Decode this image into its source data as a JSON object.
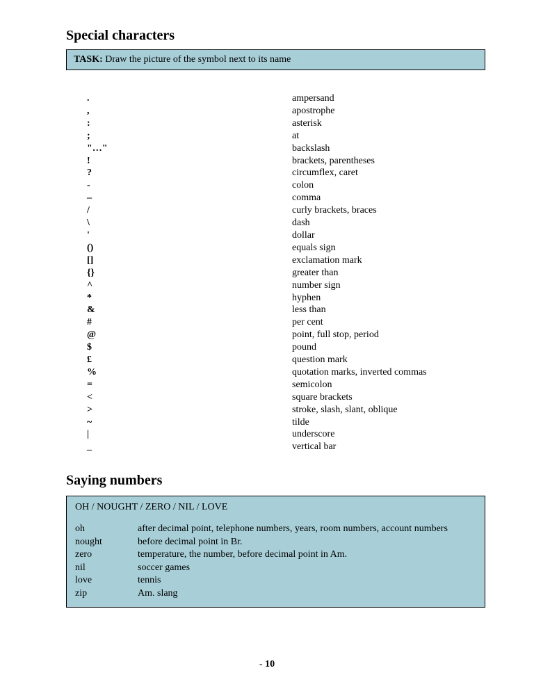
{
  "heading1": "Special characters",
  "task": {
    "label": "TASK:",
    "text": " Draw the picture of the symbol next to its name"
  },
  "symbols": [
    ".",
    ",",
    ":",
    ";",
    "\"…\"",
    "!",
    "?",
    "-",
    "–",
    "/",
    "\\",
    "'",
    "()",
    "[]",
    "{}",
    "^",
    "*",
    "&",
    "#",
    "@",
    "$",
    "£",
    "%",
    "=",
    "<",
    ">",
    "~",
    "|",
    "_"
  ],
  "names": [
    "ampersand",
    "apostrophe",
    "asterisk",
    "at",
    "backslash",
    "brackets, parentheses",
    "circumflex, caret",
    "colon",
    "comma",
    "curly brackets, braces",
    "dash",
    "dollar",
    "equals sign",
    "exclamation mark",
    "greater than",
    "number sign",
    "hyphen",
    "less than",
    "per cent",
    "point, full stop, period",
    "pound",
    "question mark",
    "quotation marks, inverted commas",
    "semicolon",
    "square brackets",
    "stroke, slash, slant, oblique",
    "tilde",
    "underscore",
    "vertical bar"
  ],
  "heading2": "Saying numbers",
  "numbersBox": {
    "title": "OH / NOUGHT / ZERO / NIL / LOVE",
    "rows": [
      {
        "term": "oh",
        "def": "after decimal point, telephone numbers, years, room numbers, account numbers"
      },
      {
        "term": "nought",
        "def": "before decimal point in Br."
      },
      {
        "term": "zero",
        "def": "temperature, the number, before decimal point in Am."
      },
      {
        "term": "nil",
        "def": "soccer games"
      },
      {
        "term": "love",
        "def": "tennis"
      },
      {
        "term": "zip",
        "def": "Am. slang"
      }
    ]
  },
  "footer": {
    "dash": "-   ",
    "page": "10"
  }
}
